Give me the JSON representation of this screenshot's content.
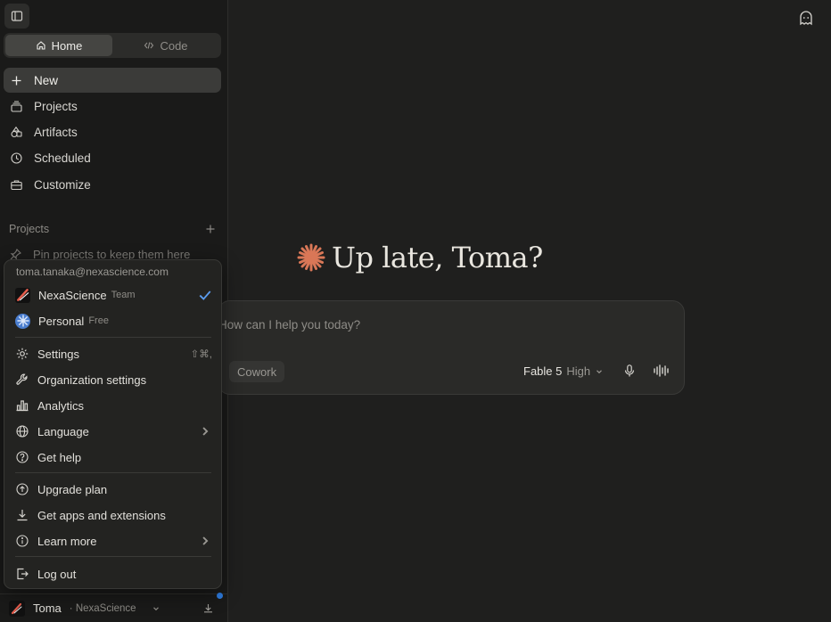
{
  "sidebar": {
    "tabs": [
      {
        "label": "Home",
        "active": true
      },
      {
        "label": "Code",
        "active": false
      }
    ],
    "nav": [
      {
        "label": "New",
        "icon": "plus-icon"
      },
      {
        "label": "Projects",
        "icon": "projects-icon"
      },
      {
        "label": "Artifacts",
        "icon": "artifacts-icon"
      },
      {
        "label": "Scheduled",
        "icon": "clock-icon"
      },
      {
        "label": "Customize",
        "icon": "briefcase-icon"
      }
    ],
    "projects_heading": "Projects",
    "pin_hint": "Pin projects to keep them here",
    "user": {
      "name": "Toma",
      "org": "· NexaScience"
    }
  },
  "main": {
    "greeting": "Up late, Toma?",
    "composer_placeholder": "How can I help you today?",
    "cowork_label": "Cowork",
    "model_name": "Fable 5",
    "model_level": "High"
  },
  "menu": {
    "email": "toma.tanaka@nexascience.com",
    "accounts": [
      {
        "name": "NexaScience",
        "tag": "Team",
        "selected": true
      },
      {
        "name": "Personal",
        "tag": "Free",
        "selected": false
      }
    ],
    "settings": {
      "label": "Settings",
      "shortcut": "⇧⌘,"
    },
    "organization_settings": "Organization settings",
    "analytics": "Analytics",
    "language": "Language",
    "get_help": "Get help",
    "upgrade_plan": "Upgrade plan",
    "get_apps": "Get apps and extensions",
    "learn_more": "Learn more",
    "log_out": "Log out"
  },
  "colors": {
    "accent": "#d97757",
    "notification": "#2f7de1",
    "check": "#5b9cf0"
  }
}
